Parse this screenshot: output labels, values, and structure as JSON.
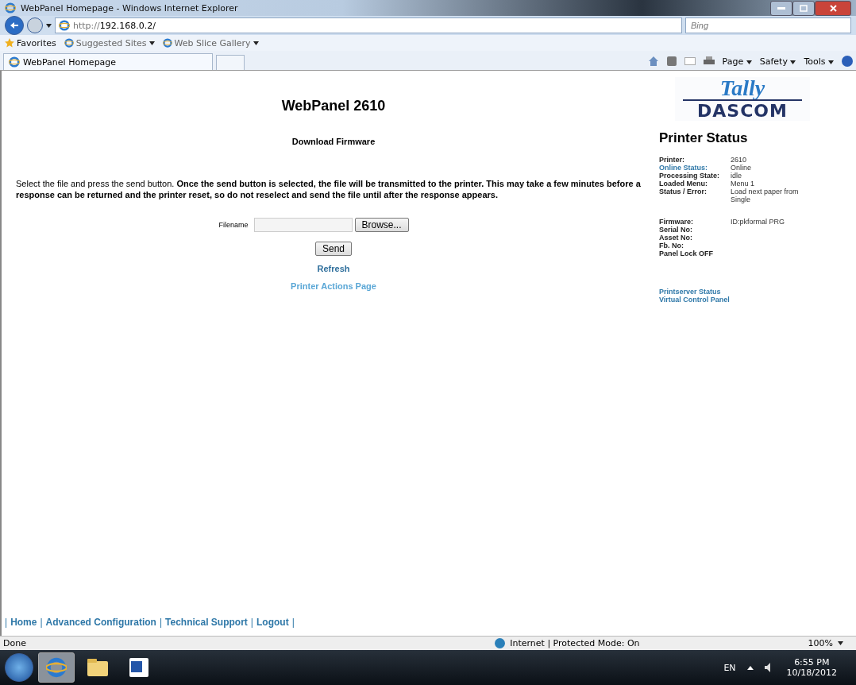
{
  "window": {
    "title": "WebPanel Homepage - Windows Internet Explorer"
  },
  "address_bar": {
    "url_prefix": "http://",
    "url_host": "192.168.0.2/"
  },
  "search": {
    "placeholder": "Bing"
  },
  "favorites_bar": {
    "label": "Favorites",
    "items": [
      "Suggested Sites",
      "Web Slice Gallery"
    ]
  },
  "tabs": [
    {
      "label": "WebPanel Homepage",
      "selected": true
    }
  ],
  "command_bar": [
    "Page",
    "Safety",
    "Tools"
  ],
  "page": {
    "heading": "WebPanel 2610",
    "subheading": "Download Firmware",
    "instructions": "Select the file and press the send button. **Once the send button is selected, the file will be transmitted to the printer. This may take a few minutes before a response can be returned and the printer reset, so do not reselect and send the file until after the response appears.**",
    "filename_label": "Filename",
    "browse_button": "Browse...",
    "send_button": "Send",
    "links": [
      {
        "label": "Refresh",
        "kind": "dark"
      },
      {
        "label": "Printer Actions Page",
        "kind": "light"
      }
    ],
    "footer": {
      "separator": "|",
      "links": [
        "Home",
        "Advanced Configuration",
        "Technical Support",
        "Logout"
      ]
    }
  },
  "sidebar": {
    "logo": {
      "top": "Tally",
      "bottom": "DASCOM"
    },
    "title": "Printer Status",
    "groups": [
      [
        {
          "label": "Printer:",
          "value": "2610",
          "kind": "plain"
        },
        {
          "label": "Online Status:",
          "value": "Online",
          "kind": "link"
        },
        {
          "label": "Processing State:",
          "value": "idle",
          "kind": "plain"
        },
        {
          "label": "Loaded Menu:",
          "value": "Menu 1",
          "kind": "plain"
        },
        {
          "label": "Status / Error:",
          "value": "Load next paper from Single",
          "kind": "plain"
        }
      ],
      [
        {
          "label": "Firmware:",
          "value": "ID:pkformal PRG",
          "kind": "plain"
        },
        {
          "label": "Serial No:",
          "kind": "plain"
        },
        {
          "label": "Asset No:",
          "kind": "plain"
        },
        {
          "label": "Fb. No:",
          "kind": "plain"
        },
        {
          "label": "Panel Lock OFF",
          "kind": "plain"
        }
      ]
    ],
    "links": [
      "Printserver Status",
      "Virtual Control Panel"
    ]
  },
  "status_bar": {
    "text": "Done",
    "zone": "Internet | Protected Mode: On",
    "zoom": "100%"
  },
  "taskbar": {
    "language": "EN",
    "time": "6:55 PM",
    "date": "10/18/2012"
  }
}
